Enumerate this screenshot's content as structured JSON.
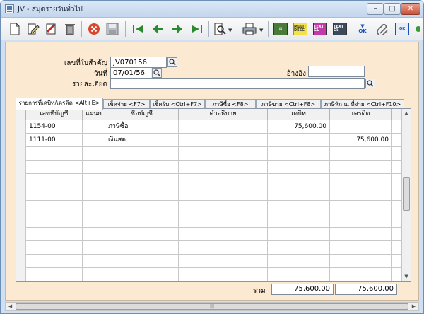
{
  "window": {
    "title": "JV - สมุดรายวันทั่วไป",
    "controls": {
      "minimize": "–",
      "maximize": "□",
      "close": "✕"
    }
  },
  "toolbar": {
    "icons": [
      "new-icon",
      "edit-icon",
      "void-icon",
      "delete-icon",
      "cancel-icon",
      "save-icon",
      "first-icon",
      "prev-icon",
      "next-icon",
      "last-icon",
      "find-icon",
      "print-icon",
      "report-icon",
      "multi-desc-icon",
      "text-gl-icon",
      "post-ok-icon",
      "attachment-icon",
      "approve-ok-icon"
    ],
    "labels": {
      "multi_desc": "MULTI DESC",
      "text_gl": "TEXT GL",
      "ok": "OK"
    }
  },
  "form": {
    "doc_no_label": "เลขที่ใบสำคัญ",
    "doc_no_value": "JV070156",
    "date_label": "วันที่",
    "date_value": "07/01/56",
    "ref_label": "อ้างอิง",
    "ref_value": "",
    "detail_label": "รายละเอียด",
    "detail_value": ""
  },
  "tabs": [
    {
      "label": "รายการที่เดบิท/เครดิต <Alt+E>"
    },
    {
      "label": "เช็คจ่าย <F7>"
    },
    {
      "label": "เช็ครับ <Ctrl+F7>"
    },
    {
      "label": "ภาษีซื้อ <F8>"
    },
    {
      "label": "ภาษีขาย <Ctrl+F8>"
    },
    {
      "label": "ภาษีหัก ณ ที่จ่าย <Ctrl+F10>"
    }
  ],
  "grid": {
    "columns": [
      "เลขที่บัญชี",
      "แผนก",
      "ชื่อบัญชี",
      "คำอธิบาย",
      "เดบิท",
      "เครดิต"
    ],
    "rows": [
      {
        "account": "1154-00",
        "dept": "",
        "name": "ภาษีซื้อ",
        "desc": "",
        "debit": "75,600.00",
        "credit": ""
      },
      {
        "account": "1111-00",
        "dept": "",
        "name": "เงินสด",
        "desc": "",
        "debit": "",
        "credit": "75,600.00"
      },
      {
        "account": "",
        "dept": "",
        "name": "",
        "desc": "",
        "debit": "",
        "credit": ""
      },
      {
        "account": "",
        "dept": "",
        "name": "",
        "desc": "",
        "debit": "",
        "credit": ""
      },
      {
        "account": "",
        "dept": "",
        "name": "",
        "desc": "",
        "debit": "",
        "credit": ""
      },
      {
        "account": "",
        "dept": "",
        "name": "",
        "desc": "",
        "debit": "",
        "credit": ""
      },
      {
        "account": "",
        "dept": "",
        "name": "",
        "desc": "",
        "debit": "",
        "credit": ""
      },
      {
        "account": "",
        "dept": "",
        "name": "",
        "desc": "",
        "debit": "",
        "credit": ""
      },
      {
        "account": "",
        "dept": "",
        "name": "",
        "desc": "",
        "debit": "",
        "credit": ""
      },
      {
        "account": "",
        "dept": "",
        "name": "",
        "desc": "",
        "debit": "",
        "credit": ""
      },
      {
        "account": "",
        "dept": "",
        "name": "",
        "desc": "",
        "debit": "",
        "credit": ""
      },
      {
        "account": "",
        "dept": "",
        "name": "",
        "desc": "",
        "debit": "",
        "credit": ""
      }
    ]
  },
  "totals": {
    "label": "รวม",
    "debit": "75,600.00",
    "credit": "75,600.00"
  }
}
